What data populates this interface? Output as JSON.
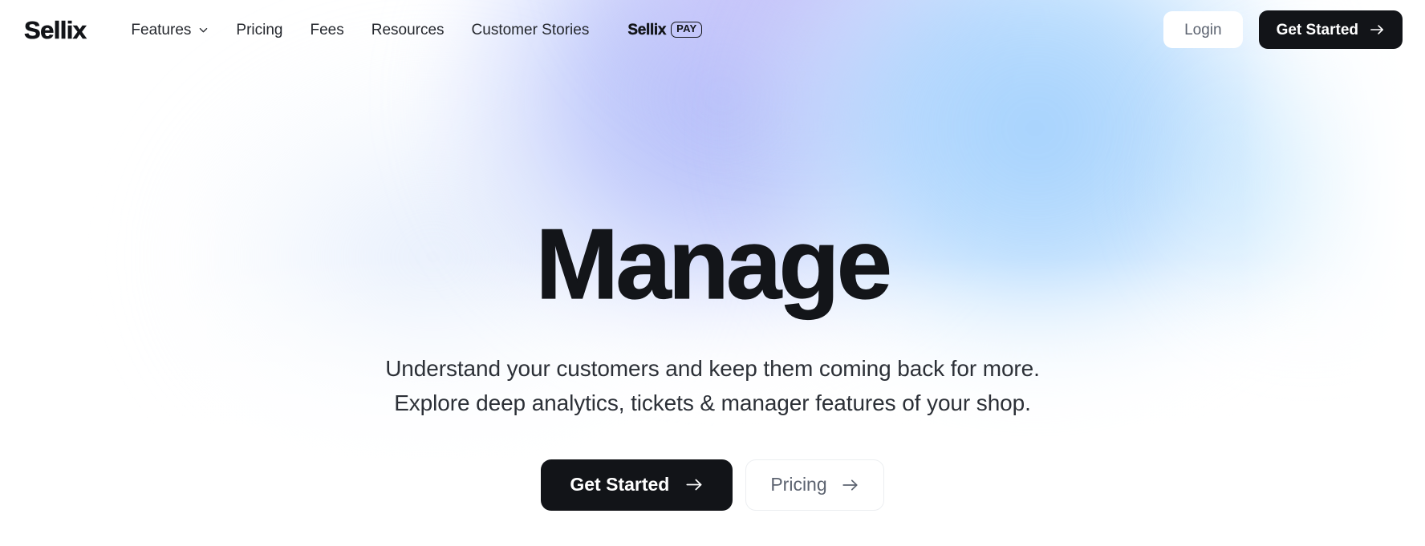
{
  "header": {
    "brand": "Sellix",
    "nav_items": [
      {
        "label": "Features",
        "icon": "chevron-down-icon",
        "has_dropdown": true
      },
      {
        "label": "Pricing",
        "has_dropdown": false
      },
      {
        "label": "Fees",
        "has_dropdown": false
      },
      {
        "label": "Resources",
        "has_dropdown": false
      },
      {
        "label": "Customer Stories",
        "has_dropdown": false
      }
    ],
    "pay_badge": {
      "word": "Sellix",
      "chip": "PAY"
    },
    "login_label": "Login",
    "get_started_label": "Get Started",
    "get_started_icon": "arrow-right-icon"
  },
  "hero": {
    "title": "Manage",
    "subtitle_line_1": "Understand your customers and keep them coming back for more.",
    "subtitle_line_2": "Explore deep analytics, tickets & manager features of your shop.",
    "cta_primary_label": "Get Started",
    "cta_primary_icon": "arrow-right-icon",
    "cta_secondary_label": "Pricing",
    "cta_secondary_icon": "arrow-right-icon"
  },
  "colors": {
    "ink": "#121418",
    "body_text": "#2c3037",
    "muted_text": "#5c6370",
    "button_dark": "#121418",
    "button_light": "#ffffff",
    "gradient_periwinkle": "#b0bafa",
    "gradient_lavender": "#c4baf8",
    "gradient_sky_blue": "#9ecefd",
    "page_background": "#ffffff"
  }
}
